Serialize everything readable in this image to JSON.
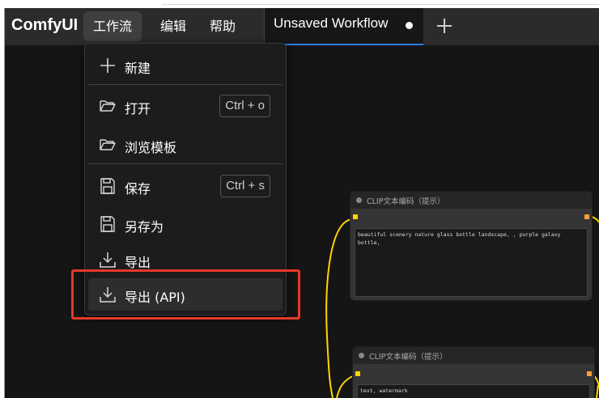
{
  "app": {
    "brand": "ComfyUI"
  },
  "menu": {
    "items": [
      {
        "label": "工作流",
        "active": true
      },
      {
        "label": "编辑",
        "active": false
      },
      {
        "label": "帮助",
        "active": false
      }
    ]
  },
  "tab": {
    "title": "Unsaved Workflow",
    "modified": true
  },
  "workflow_menu": {
    "new": "新建",
    "open": "打开",
    "open_shortcut": "Ctrl + o",
    "browse_templates": "浏览模板",
    "save": "保存",
    "save_shortcut": "Ctrl + s",
    "save_as": "另存为",
    "export": "导出",
    "export_api": "导出 (API)"
  },
  "nodes": [
    {
      "title": "CLIP文本编码（提示）",
      "text": "beautiful scenery nature glass bottle landscape, , purple galaxy bottle,"
    },
    {
      "title": "CLIP文本编码（提示）",
      "text": "text, watermark"
    }
  ],
  "colors": {
    "accent_tab": "#2f7de1",
    "highlight_box": "#e53929",
    "wire": "#ffd500",
    "input_port": "#ffd500",
    "output_port": "#ff9c3b"
  }
}
